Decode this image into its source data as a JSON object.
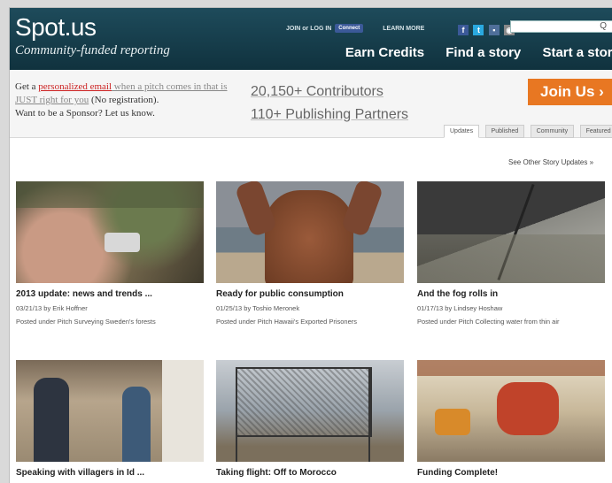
{
  "header": {
    "logo": "Spot.us",
    "tagline": "Community-funded reporting",
    "join_login": "JOIN or LOG IN",
    "connect": "Connect",
    "learn_more": "LEARN MORE",
    "search_placeholder": "",
    "nav": [
      "Earn Credits",
      "Find a story",
      "Start a story"
    ]
  },
  "info": {
    "pitch_prefix": "Get a ",
    "pitch_link": "personalized email",
    "pitch_rest": " when a pitch comes in that is JUST right for you",
    "pitch_suffix": " (No registration).",
    "sponsor": "Want to be a Sponsor? Let us know.",
    "contributors": "20,150+ Contributors",
    "partners": "110+ Publishing Partners",
    "join_button": "Join Us ›",
    "tabs": [
      "Updates",
      "Published",
      "Community",
      "Featured"
    ]
  },
  "other_updates": "See Other Story Updates »",
  "stories": [
    {
      "title": "2013 update: news and trends ...",
      "meta": "03/21/13 by Erik Hoffner",
      "posted": "Posted under Pitch Surveying Sweden's forests"
    },
    {
      "title": "Ready for public consumption",
      "meta": "01/25/13 by Toshio Meronek",
      "posted": "Posted under Pitch Hawaii's Exported Prisoners"
    },
    {
      "title": "And the fog rolls in",
      "meta": "01/17/13 by Lindsey Hoshaw",
      "posted": "Posted under Pitch Collecting water from thin air"
    },
    {
      "title": "Speaking with villagers in Id ...",
      "meta": "",
      "posted": ""
    },
    {
      "title": "Taking flight: Off to Morocco",
      "meta": "",
      "posted": ""
    },
    {
      "title": "Funding Complete!",
      "meta": "",
      "posted": ""
    }
  ]
}
